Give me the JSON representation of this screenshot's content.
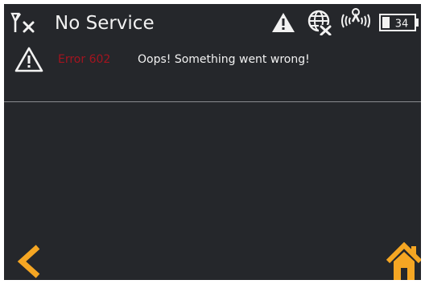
{
  "status_bar": {
    "title": "No Service",
    "battery_level": "34",
    "icons": [
      "no-signal-icon",
      "warning-icon",
      "globe-disabled-icon",
      "wifi-icon",
      "battery-icon"
    ]
  },
  "error": {
    "code": "Error 602",
    "message": "Oops! Something went wrong!",
    "icon": "warning-icon"
  },
  "navigation": {
    "back_icon": "chevron-left-icon",
    "home_icon": "home-icon"
  },
  "colors": {
    "background": "#25272b",
    "text": "#f2f2f2",
    "error_code": "#a3141f",
    "accent": "#f5a623",
    "divider": "#8a8c90"
  }
}
